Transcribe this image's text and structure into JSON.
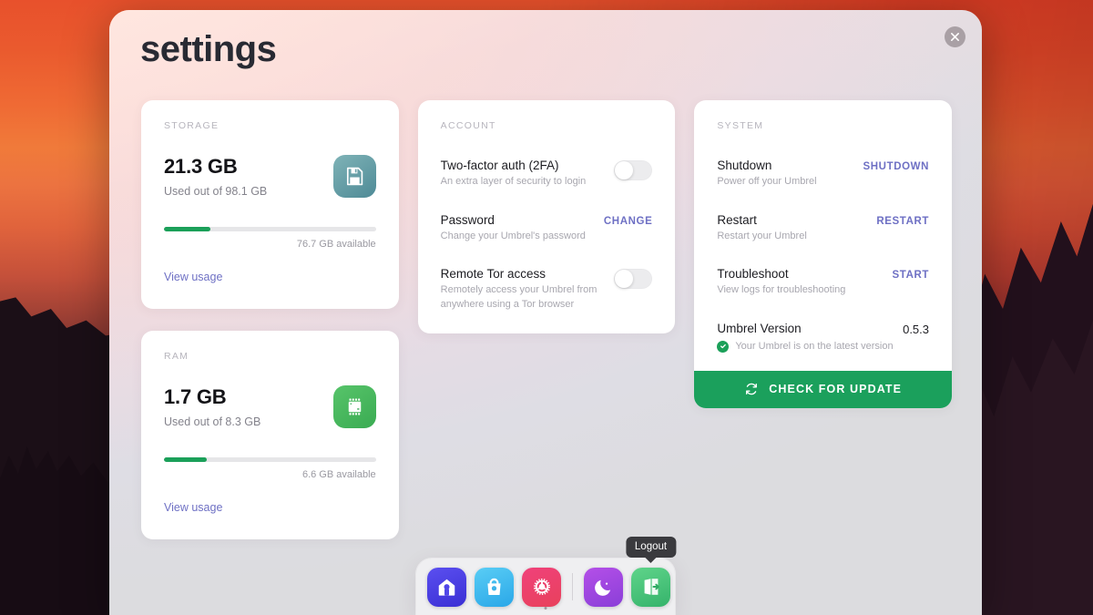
{
  "window": {
    "title": "settings",
    "close_icon": "close-icon"
  },
  "storage": {
    "label": "STORAGE",
    "value": "21.3 GB",
    "subtitle": "Used out of 98.1 GB",
    "available_note": "76.7 GB available",
    "used_percent": 22,
    "link_label": "View usage",
    "icon": "floppy-disk-icon",
    "bar_color": "#1ba059"
  },
  "ram": {
    "label": "RAM",
    "value": "1.7 GB",
    "subtitle": "Used out of 8.3 GB",
    "available_note": "6.6 GB available",
    "used_percent": 20,
    "link_label": "View usage",
    "icon": "memory-chip-icon",
    "bar_color": "#1ba059"
  },
  "account": {
    "label": "ACCOUNT",
    "rows": [
      {
        "title": "Two-factor auth (2FA)",
        "desc": "An extra layer of security to login",
        "control": "toggle",
        "state": "off"
      },
      {
        "title": "Password",
        "desc": "Change your Umbrel's password",
        "control": "action",
        "action_label": "CHANGE"
      },
      {
        "title": "Remote Tor access",
        "desc": "Remotely access your Umbrel from anywhere using a Tor browser",
        "control": "toggle",
        "state": "off"
      }
    ]
  },
  "system": {
    "label": "SYSTEM",
    "rows": [
      {
        "title": "Shutdown",
        "desc": "Power off your Umbrel",
        "control": "action",
        "action_label": "SHUTDOWN"
      },
      {
        "title": "Restart",
        "desc": "Restart your Umbrel",
        "control": "action",
        "action_label": "RESTART"
      },
      {
        "title": "Troubleshoot",
        "desc": "View logs for troubleshooting",
        "control": "action",
        "action_label": "START"
      }
    ],
    "version": {
      "title": "Umbrel Version",
      "value": "0.5.3",
      "status_text": "Your Umbrel is on the latest version",
      "status_icon": "check-circle-icon",
      "status_color": "#1ba059"
    },
    "update_button": {
      "label": "CHECK FOR UPDATE",
      "icon": "refresh-icon",
      "color": "#1ba05c"
    }
  },
  "dock": {
    "items": [
      {
        "name": "home",
        "icon": "home-icon",
        "color": "#5b4ff0",
        "active": false
      },
      {
        "name": "app-store",
        "icon": "shopping-bag-icon",
        "color": "#2aa7e8",
        "active": false
      },
      {
        "name": "settings",
        "icon": "gear-icon",
        "color": "#e8415c",
        "active": true
      },
      {
        "name": "sleep",
        "icon": "moon-icon",
        "color": "#8a3fd8",
        "active": false
      },
      {
        "name": "logout",
        "icon": "logout-door-icon",
        "color": "#35b36b",
        "active": false
      }
    ],
    "tooltip": "Logout"
  }
}
